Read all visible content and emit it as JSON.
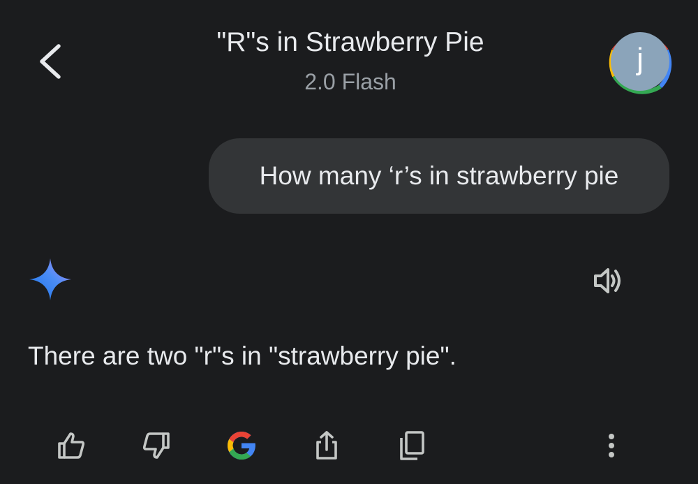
{
  "header": {
    "title": "\"R\"s in Strawberry Pie",
    "subtitle": "2.0 Flash",
    "back_icon": "chevron-left-icon"
  },
  "avatar": {
    "initial": "j",
    "ring_colors": [
      "#ea4335",
      "#4285f4",
      "#34a853",
      "#fbbc05"
    ],
    "fill_color": "#8ba4ba"
  },
  "conversation": {
    "user_message": "How many ‘r’s in strawberry pie",
    "assistant_icon": "gemini-sparkle-icon",
    "assistant_response": "There are two \"r\"s in \"strawberry pie\".",
    "speaker_icon": "speaker-icon"
  },
  "actions": [
    {
      "name": "thumbs-up",
      "icon": "thumbs-up-icon"
    },
    {
      "name": "thumbs-down",
      "icon": "thumbs-down-icon"
    },
    {
      "name": "google-search",
      "icon": "google-g-icon"
    },
    {
      "name": "share",
      "icon": "share-icon"
    },
    {
      "name": "copy",
      "icon": "copy-icon"
    },
    {
      "name": "more",
      "icon": "more-vert-icon"
    }
  ],
  "colors": {
    "background": "#1b1c1e",
    "bubble": "#333537",
    "text": "#e8eaed",
    "muted": "#9aa0a6",
    "icon": "#c4c7c5"
  }
}
